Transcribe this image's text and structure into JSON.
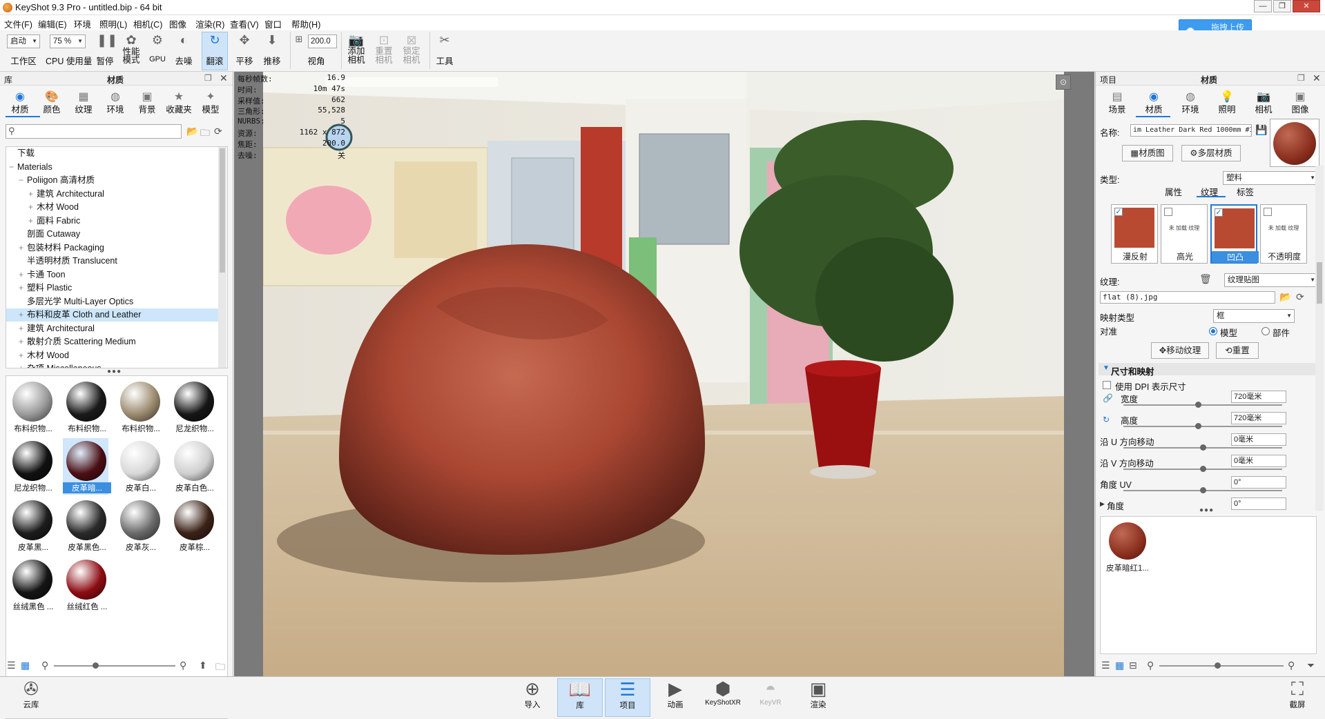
{
  "window": {
    "title": "KeyShot 9.3 Pro  - untitled.bip  - 64 bit"
  },
  "menu": [
    "文件(F)",
    "编辑(E)",
    "环境",
    "照明(L)",
    "相机(C)",
    "图像",
    "渲染(R)",
    "查看(V)",
    "窗口",
    "帮助(H)"
  ],
  "upload_button": "拖拽上传",
  "toolbar": {
    "workspace_value": "启动",
    "workspace_label": "工作区",
    "cpu_value": "75 %",
    "cpu_label": "CPU 使用量",
    "pause": "暂停",
    "perf_label": "性能\n模式",
    "gpu": "GPU",
    "denoise": "去噪",
    "tumble": "翻滚",
    "pan": "平移",
    "dolly": "推移",
    "fov_value": "200.0",
    "fov_label": "视角",
    "add_camera": "添加\n相机",
    "reset_camera": "重置\n相机",
    "lock_camera": "锁定\n相机",
    "tools": "工具"
  },
  "library": {
    "title": "库",
    "panel_title": "材质",
    "tabs": [
      "材质",
      "颜色",
      "纹理",
      "环境",
      "背景",
      "收藏夹",
      "模型"
    ],
    "tree": [
      {
        "label": "下载",
        "indent": 0,
        "pm": ""
      },
      {
        "label": "Materials",
        "indent": 0,
        "pm": "−"
      },
      {
        "label": "Poliigon 高清材质",
        "indent": 1,
        "pm": "−"
      },
      {
        "label": "建筑 Architectural",
        "indent": 2,
        "pm": "+"
      },
      {
        "label": "木材 Wood",
        "indent": 2,
        "pm": "+"
      },
      {
        "label": "面料 Fabric",
        "indent": 2,
        "pm": "+"
      },
      {
        "label": "剖面 Cutaway",
        "indent": 1,
        "pm": ""
      },
      {
        "label": "包装材料 Packaging",
        "indent": 1,
        "pm": "+"
      },
      {
        "label": "半透明材质 Translucent",
        "indent": 1,
        "pm": ""
      },
      {
        "label": "卡通 Toon",
        "indent": 1,
        "pm": "+"
      },
      {
        "label": "塑料 Plastic",
        "indent": 1,
        "pm": "+"
      },
      {
        "label": "多层光学 Multi-Layer Optics",
        "indent": 1,
        "pm": ""
      },
      {
        "label": "布料和皮革 Cloth and Leather",
        "indent": 1,
        "pm": "+"
      },
      {
        "label": "建筑 Architectural",
        "indent": 1,
        "pm": "+"
      },
      {
        "label": "散射介质 Scattering Medium",
        "indent": 1,
        "pm": "+"
      },
      {
        "label": "木材 Wood",
        "indent": 1,
        "pm": "+"
      },
      {
        "label": "杂项 Miscellaneous",
        "indent": 1,
        "pm": "+"
      }
    ],
    "selected_index": 12,
    "thumbnails": [
      {
        "label": "布料织物...",
        "color": "#9a9a9a"
      },
      {
        "label": "布料织物...",
        "color": "#1a1a1a"
      },
      {
        "label": "布料织物...",
        "color": "#9b8a6e"
      },
      {
        "label": "尼龙织物...",
        "color": "#161616"
      },
      {
        "label": "尼龙织物...",
        "color": "#111111"
      },
      {
        "label": "皮革暗...",
        "color": "#4a0f14"
      },
      {
        "label": "皮革白...",
        "color": "#d8d8d8"
      },
      {
        "label": "皮革白色...",
        "color": "#cfcfcf"
      },
      {
        "label": "皮革黑...",
        "color": "#1c1c1c"
      },
      {
        "label": "皮革黑色...",
        "color": "#2a2a2a"
      },
      {
        "label": "皮革灰...",
        "color": "#6a6a6a"
      },
      {
        "label": "皮革棕...",
        "color": "#3b2218"
      },
      {
        "label": "丝绒黑色 ...",
        "color": "#151515"
      },
      {
        "label": "丝绒红色 ...",
        "color": "#8c0d14"
      }
    ],
    "selected_thumb": 5
  },
  "hud": [
    {
      "k": "每秒帧数:",
      "v": "16.9"
    },
    {
      "k": "时间:",
      "v": "10m 47s"
    },
    {
      "k": "采样值:",
      "v": "662"
    },
    {
      "k": "三角形:",
      "v": "55,528"
    },
    {
      "k": "NURBS:",
      "v": "5"
    },
    {
      "k": "资源:",
      "v": "1162 x 872"
    },
    {
      "k": "焦距:",
      "v": "200.0"
    },
    {
      "k": "去噪:",
      "v": "关"
    }
  ],
  "project": {
    "title": "项目",
    "panel_title": "材质",
    "tabs": [
      "场景",
      "材质",
      "环境",
      "照明",
      "相机",
      "图像"
    ],
    "name_label": "名称:",
    "name_value": "im Leather Dark Red 1000mm #3",
    "material_graph_btn": "材质图",
    "multi_material_btn": "多层材质",
    "type_label": "类型:",
    "type_value": "塑料",
    "subtabs": [
      "属性",
      "纹理",
      "标签"
    ],
    "swatches": [
      {
        "label": "漫反射",
        "checked": true,
        "color": "#b84a32"
      },
      {
        "label": "高光",
        "checked": false,
        "color": ""
      },
      {
        "label": "凹凸",
        "checked": true,
        "color": "#b84a32"
      },
      {
        "label": "不透明度",
        "checked": false,
        "color": ""
      }
    ],
    "swatch_empty_text": "未 加载 纹理",
    "texture_label": "纹理:",
    "texture_type": "纹理贴图",
    "texture_file": "flat (8).jpg",
    "mapping_label": "映射类型",
    "mapping_value": "框",
    "align_label": "对准",
    "align_model": "模型",
    "align_part": "部件",
    "move_texture_btn": "移动纹理",
    "reset_btn": "重置",
    "section_size": "尺寸和映射",
    "use_dpi": "使用 DPI 表示尺寸",
    "width_label": "宽度",
    "width_value": "720毫米",
    "height_label": "高度",
    "height_value": "720毫米",
    "u_label": "沿 U 方向移动",
    "u_value": "0毫米",
    "v_label": "沿 V 方向移动",
    "v_value": "0毫米",
    "angle_label": "角度 UV",
    "angle_value": "0°",
    "angle2_label": "角度",
    "angle2_value": "0°",
    "preview_label": "皮革暗红1..."
  },
  "bottom": {
    "cloud": "云库",
    "buttons": [
      "导入",
      "库",
      "项目",
      "动画",
      "KeyShotXR",
      "KeyVR",
      "渲染"
    ],
    "screenshot": "截屏"
  }
}
